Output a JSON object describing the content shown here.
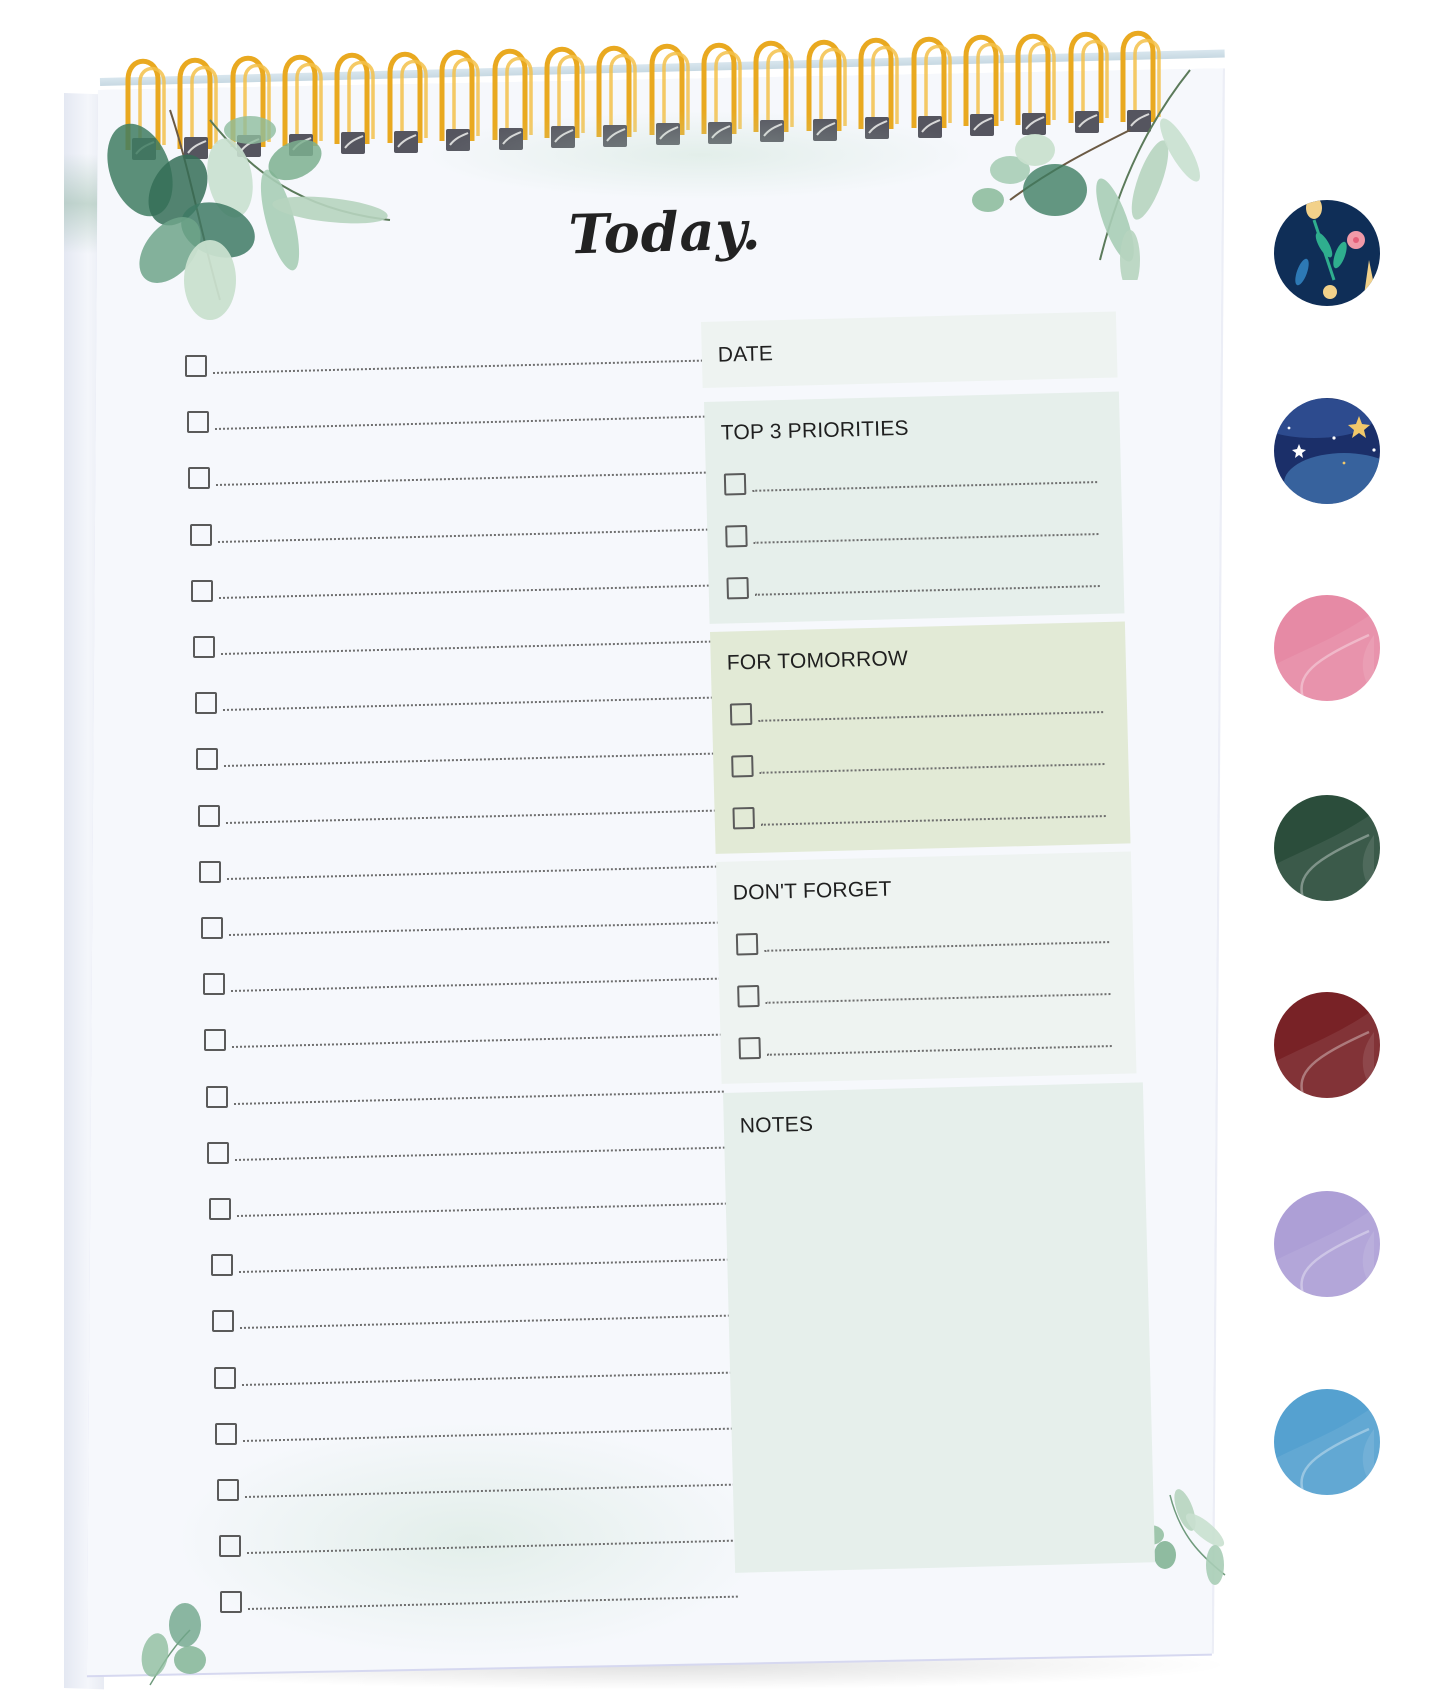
{
  "planner": {
    "title": "Today.",
    "main_task_count": 23,
    "sections": [
      {
        "id": "date",
        "label": "DATE",
        "checkbox_count": 0,
        "color": "#eef3f1"
      },
      {
        "id": "top3",
        "label": "TOP 3 PRIORITIES",
        "checkbox_count": 3,
        "color": "#e6efeb"
      },
      {
        "id": "tomorrow",
        "label": "FOR TOMORROW",
        "checkbox_count": 3,
        "color": "#e2ead6"
      },
      {
        "id": "dont_forget",
        "label": "DON'T FORGET",
        "checkbox_count": 3,
        "color": "#eef3f1"
      },
      {
        "id": "notes",
        "label": "NOTES",
        "checkbox_count": 0,
        "color": "#e6efeb"
      }
    ],
    "binding": {
      "type": "spiral",
      "ring_count": 20,
      "color": "#e9a920"
    },
    "paper_color": "#f6f8fc",
    "leaf_colors": [
      "#3f7d62",
      "#6fa58a",
      "#a9cdb6",
      "#c9e0cf"
    ]
  },
  "color_options": [
    {
      "name": "navy-floral",
      "base": "#0f2e57"
    },
    {
      "name": "starry-night",
      "base": "#1b2f69"
    },
    {
      "name": "pink",
      "base": "#e68aa5"
    },
    {
      "name": "forest-green",
      "base": "#2b4d3b"
    },
    {
      "name": "burgundy",
      "base": "#782226"
    },
    {
      "name": "lavender",
      "base": "#ad9fd6"
    },
    {
      "name": "sky-blue",
      "base": "#55a1d0"
    }
  ]
}
